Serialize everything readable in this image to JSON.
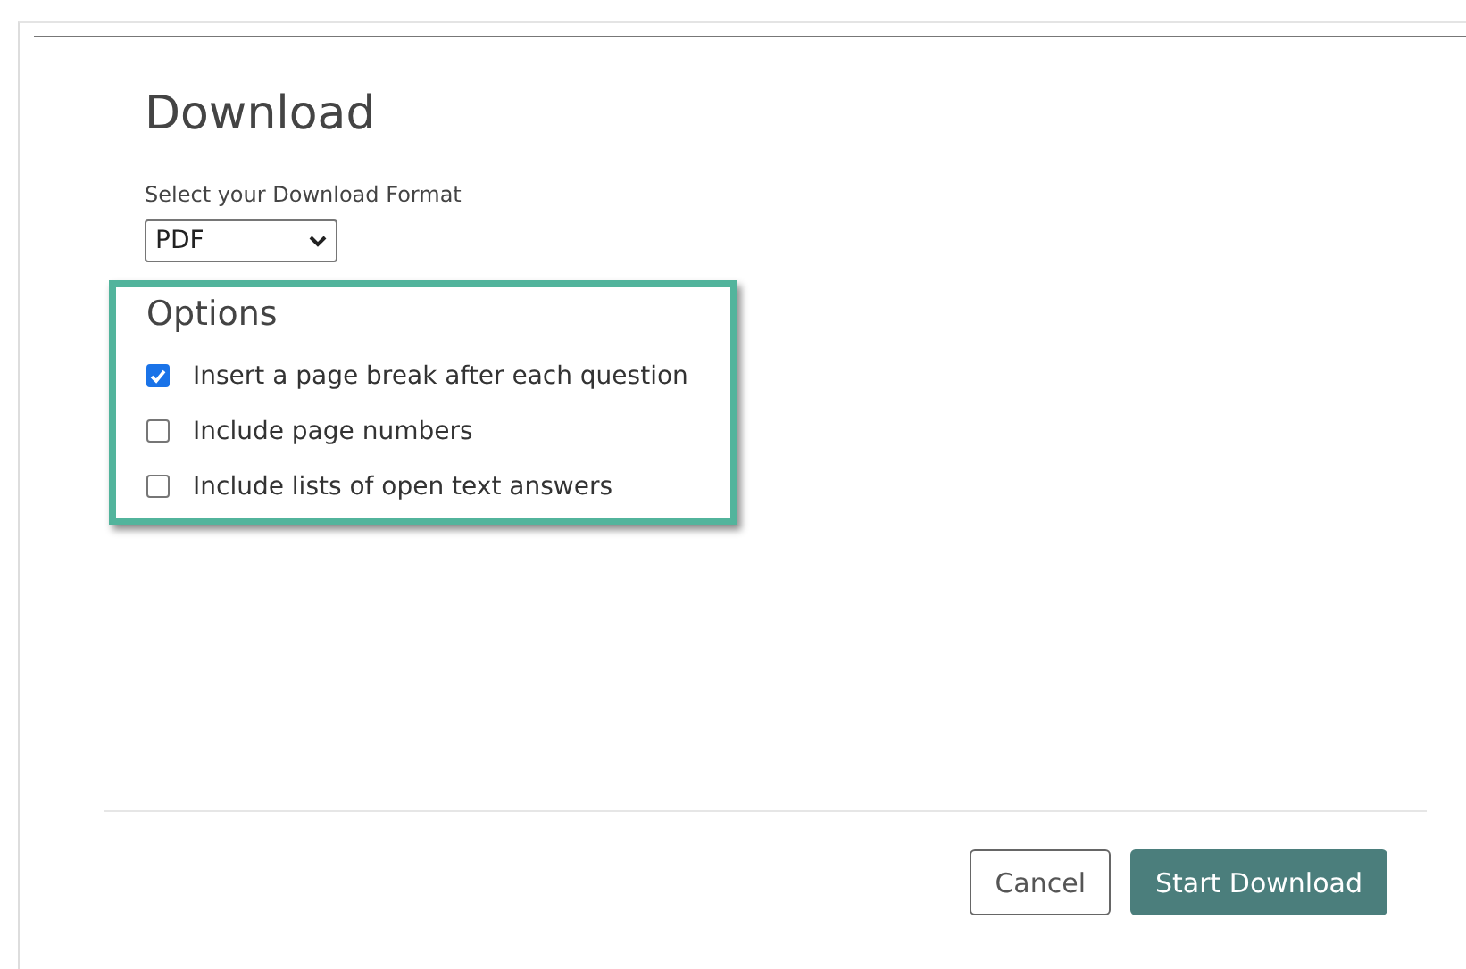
{
  "dialog": {
    "title": "Download",
    "format_label": "Select your Download Format",
    "format": {
      "value": "PDF"
    },
    "options_title": "Options",
    "options": [
      {
        "label": "Insert a page break after each question",
        "checked": true
      },
      {
        "label": "Include page numbers",
        "checked": false
      },
      {
        "label": "Include lists of open text answers",
        "checked": false
      }
    ],
    "buttons": [
      {
        "label": "Cancel",
        "kind": "secondary"
      },
      {
        "label": "Start Download",
        "kind": "primary"
      }
    ]
  }
}
